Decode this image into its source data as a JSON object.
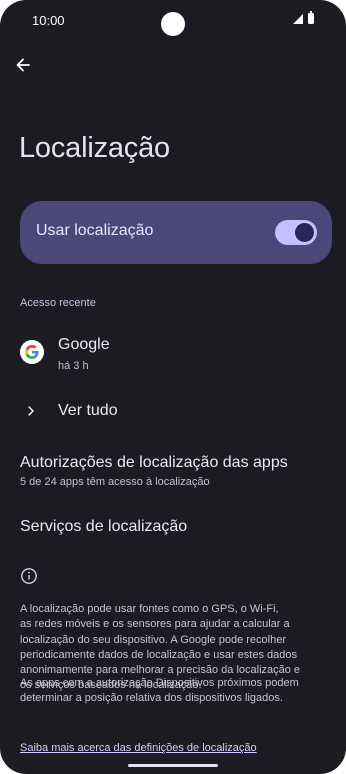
{
  "status_bar": {
    "time": "10:00"
  },
  "header": {
    "back_icon": "arrow-left-icon",
    "title": "Localização"
  },
  "use_location": {
    "label": "Usar localização",
    "enabled": true
  },
  "recent_access": {
    "heading": "Acesso recente",
    "apps": [
      {
        "name": "Google",
        "time": "há 3 h",
        "icon": "google-icon"
      }
    ],
    "see_all": "Ver tudo"
  },
  "app_permissions": {
    "title": "Autorizações de localização das apps",
    "subtitle": "5 de 24 apps têm acesso à localização"
  },
  "location_services": {
    "title": "Serviços de localização"
  },
  "info": {
    "icon": "info-icon",
    "lines1": [
      "A localização pode usar fontes como o GPS, o Wi-Fi,",
      "as redes móveis e os sensores para ajudar a calcular a",
      "localização do seu dispositivo. A Google pode recolher",
      "periodicamente dados de localização e usar estes dados",
      "anonimamente para melhorar a precisão da localização e",
      "os serviços baseados na localização."
    ],
    "lines2": [
      "As apps com a autorização Dispositivos próximos podem",
      "determinar a posição relativa dos dispositivos ligados."
    ],
    "link": "Saiba mais acerca das definições de localização"
  },
  "colors": {
    "background": "#1b1b21",
    "card": "#4b4779",
    "switch_track": "#c6bfff",
    "link": "#d5cfff"
  }
}
